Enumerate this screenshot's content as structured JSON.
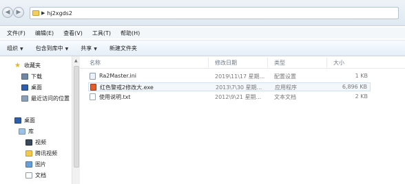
{
  "address": {
    "path": [
      "hj2xgds2"
    ]
  },
  "menu": [
    "文件(F)",
    "编辑(E)",
    "查看(V)",
    "工具(T)",
    "帮助(H)"
  ],
  "toolbar": {
    "organize": "组织",
    "include_in_library": "包含到库中",
    "share": "共享",
    "new_folder": "新建文件夹"
  },
  "nav": {
    "favorites": "收藏夹",
    "downloads": "下载",
    "desktop": "桌面",
    "recent": "最近访问的位置",
    "desktop2": "桌面",
    "library": "库",
    "videos": "视频",
    "tencent_video": "腾讯视频",
    "pictures": "图片",
    "documents": "文档"
  },
  "columns": {
    "name": "名称",
    "modified": "修改日期",
    "type": "类型",
    "size": "大小"
  },
  "files": [
    {
      "name": "Ra2Master.ini",
      "modified": "2019\\11\\17 星期...",
      "type": "配置设置",
      "size": "1 KB",
      "icon": "ini-file-icon"
    },
    {
      "name": "红色警戒2修改大.exe",
      "modified": "2013\\7\\30 星期...",
      "type": "应用程序",
      "size": "6,896 KB",
      "icon": "exe-file-icon"
    },
    {
      "name": "使用说明.txt",
      "modified": "2012\\9\\21 星期...",
      "type": "文本文档",
      "size": "2 KB",
      "icon": "txt-file-icon"
    }
  ]
}
